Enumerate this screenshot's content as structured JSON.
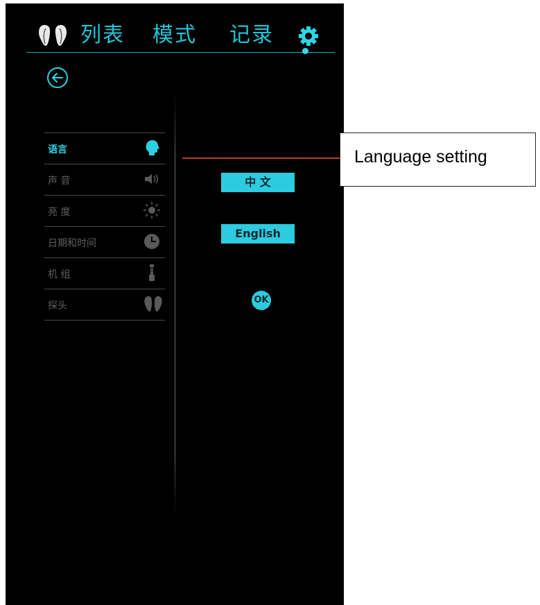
{
  "nav": {
    "tabs": [
      "列表",
      "模式",
      "记录"
    ],
    "left_icon": "probes-icon",
    "right_icon": "gear-icon",
    "accent": "#22c5d8"
  },
  "back_icon": "back-arrow-icon",
  "menu": {
    "items": [
      {
        "label": "语言",
        "icon": "head-icon",
        "active": true
      },
      {
        "label": "声 音",
        "icon": "speaker-icon",
        "active": false
      },
      {
        "label": "亮 度",
        "icon": "sun-icon",
        "active": false
      },
      {
        "label": "日期和时间",
        "icon": "clock-icon",
        "active": false
      },
      {
        "label": "机 组",
        "icon": "unit-icon",
        "active": false
      },
      {
        "label": "探头",
        "icon": "probe-icon",
        "active": false
      }
    ]
  },
  "options": {
    "chinese": "中 文",
    "english": "English",
    "ok": "OK"
  },
  "callout": {
    "text": "Language setting",
    "line_color": "#c0392b"
  }
}
